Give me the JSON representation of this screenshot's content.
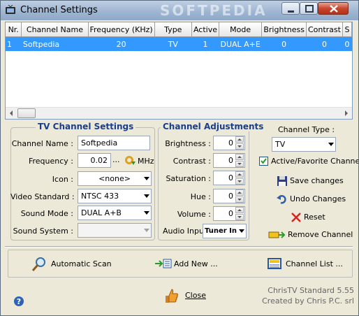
{
  "window": {
    "title": "Channel Settings",
    "watermark": "SOFTPEDIA"
  },
  "table": {
    "columns": [
      "Nr.",
      "Channel Name",
      "Frequency (KHz)",
      "Type",
      "Active",
      "Mode",
      "Brightness",
      "Contrast",
      "S"
    ],
    "rows": [
      [
        "1",
        "Softpedia",
        "20",
        "TV",
        "1",
        "DUAL A+E",
        "0",
        "0",
        "0"
      ]
    ]
  },
  "tv_settings": {
    "title": "TV Channel Settings",
    "channel_name_label": "Channel Name :",
    "channel_name_value": "Softpedia",
    "frequency_label": "Frequency :",
    "frequency_value": "0.02",
    "frequency_dots": "...",
    "frequency_unit": "MHz",
    "icon_label": "Icon :",
    "icon_value": "<none>",
    "video_standard_label": "Video Standard :",
    "video_standard_value": "NTSC 433",
    "sound_mode_label": "Sound Mode :",
    "sound_mode_value": "DUAL A+B",
    "sound_system_label": "Sound System :",
    "sound_system_value": ""
  },
  "adjustments": {
    "title": "Channel Adjustments",
    "brightness_label": "Brightness :",
    "brightness_value": "0",
    "contrast_label": "Contrast :",
    "contrast_value": "0",
    "saturation_label": "Saturation :",
    "saturation_value": "0",
    "hue_label": "Hue :",
    "hue_value": "0",
    "volume_label": "Volume :",
    "volume_value": "0",
    "audio_input_label": "Audio Input",
    "audio_input_value": "Tuner In"
  },
  "side": {
    "channel_type_label": "Channel Type :",
    "channel_type_value": "TV",
    "active_label": "Active/Favorite Channel",
    "save_label": "Save changes",
    "undo_label": "Undo Changes",
    "reset_label": "Reset",
    "remove_label": "Remove Channel"
  },
  "bottom": {
    "auto_scan_label": "Automatic Scan",
    "add_new_label": "Add New ...",
    "channel_list_label": "Channel List ...",
    "close_label": "Close",
    "version_text": "ChrisTV Standard 5.55",
    "credit_text": "Created by Chris P.C. srl"
  },
  "colors": {
    "selection": "#3399ff",
    "group_title": "#1a3e8c"
  },
  "icons": [
    "tv-icon",
    "minimize-icon",
    "maximize-icon",
    "close-icon",
    "refresh-icon",
    "floppy-disk-icon",
    "undo-arrow-icon",
    "red-x-icon",
    "remove-channel-icon",
    "magnifier-icon",
    "add-new-icon",
    "channel-list-icon",
    "thumbs-up-icon",
    "help-icon"
  ]
}
